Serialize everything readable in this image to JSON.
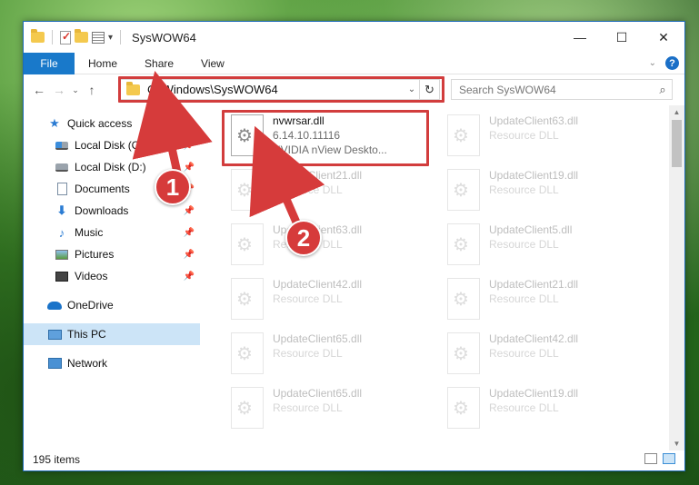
{
  "window": {
    "title": "SysWOW64",
    "controls": {
      "minimize": "—",
      "maximize": "☐",
      "close": "✕"
    }
  },
  "ribbon": {
    "tabs": [
      "File",
      "Home",
      "Share",
      "View"
    ],
    "expand_icon": "chevron-down-icon",
    "help": "?"
  },
  "address_bar": {
    "path": "C:\\Windows\\SysWOW64",
    "search_placeholder": "Search SysWOW64"
  },
  "sidebar": {
    "quick_access": "Quick access",
    "items": [
      {
        "label": "Local Disk (C:)",
        "pinned": true
      },
      {
        "label": "Local Disk (D:)",
        "pinned": true
      },
      {
        "label": "Documents",
        "pinned": true
      },
      {
        "label": "Downloads",
        "pinned": true
      },
      {
        "label": "Music",
        "pinned": true
      },
      {
        "label": "Pictures",
        "pinned": true
      },
      {
        "label": "Videos",
        "pinned": true
      }
    ],
    "onedrive": "OneDrive",
    "this_pc": "This PC",
    "network": "Network"
  },
  "files": {
    "highlighted": {
      "name": "nvwrsar.dll",
      "version": "6.14.10.11116",
      "description": "NVIDIA nView Deskto..."
    },
    "left_column": [
      {
        "name": "UpdateClient21.dll",
        "type": "Resource DLL"
      },
      {
        "name": "UpdateClient63.dll",
        "type": "Resource DLL"
      },
      {
        "name": "UpdateClient42.dll",
        "type": "Resource DLL"
      },
      {
        "name": "UpdateClient65.dll",
        "type": "Resource DLL"
      },
      {
        "name": "UpdateClient65.dll",
        "type": "Resource DLL"
      }
    ],
    "right_column": [
      {
        "name": "UpdateClient63.dll",
        "type": "Resource DLL"
      },
      {
        "name": "UpdateClient19.dll",
        "type": "Resource DLL"
      },
      {
        "name": "UpdateClient5.dll",
        "type": "Resource DLL"
      },
      {
        "name": "UpdateClient21.dll",
        "type": "Resource DLL"
      },
      {
        "name": "UpdateClient42.dll",
        "type": "Resource DLL"
      },
      {
        "name": "UpdateClient19.dll",
        "type": "Resource DLL"
      }
    ]
  },
  "status": {
    "item_count": "195 items"
  },
  "callouts": {
    "one": "1",
    "two": "2"
  },
  "colors": {
    "accent": "#1979ca",
    "highlight": "#d23d3d",
    "selected": "#cce4f7"
  }
}
